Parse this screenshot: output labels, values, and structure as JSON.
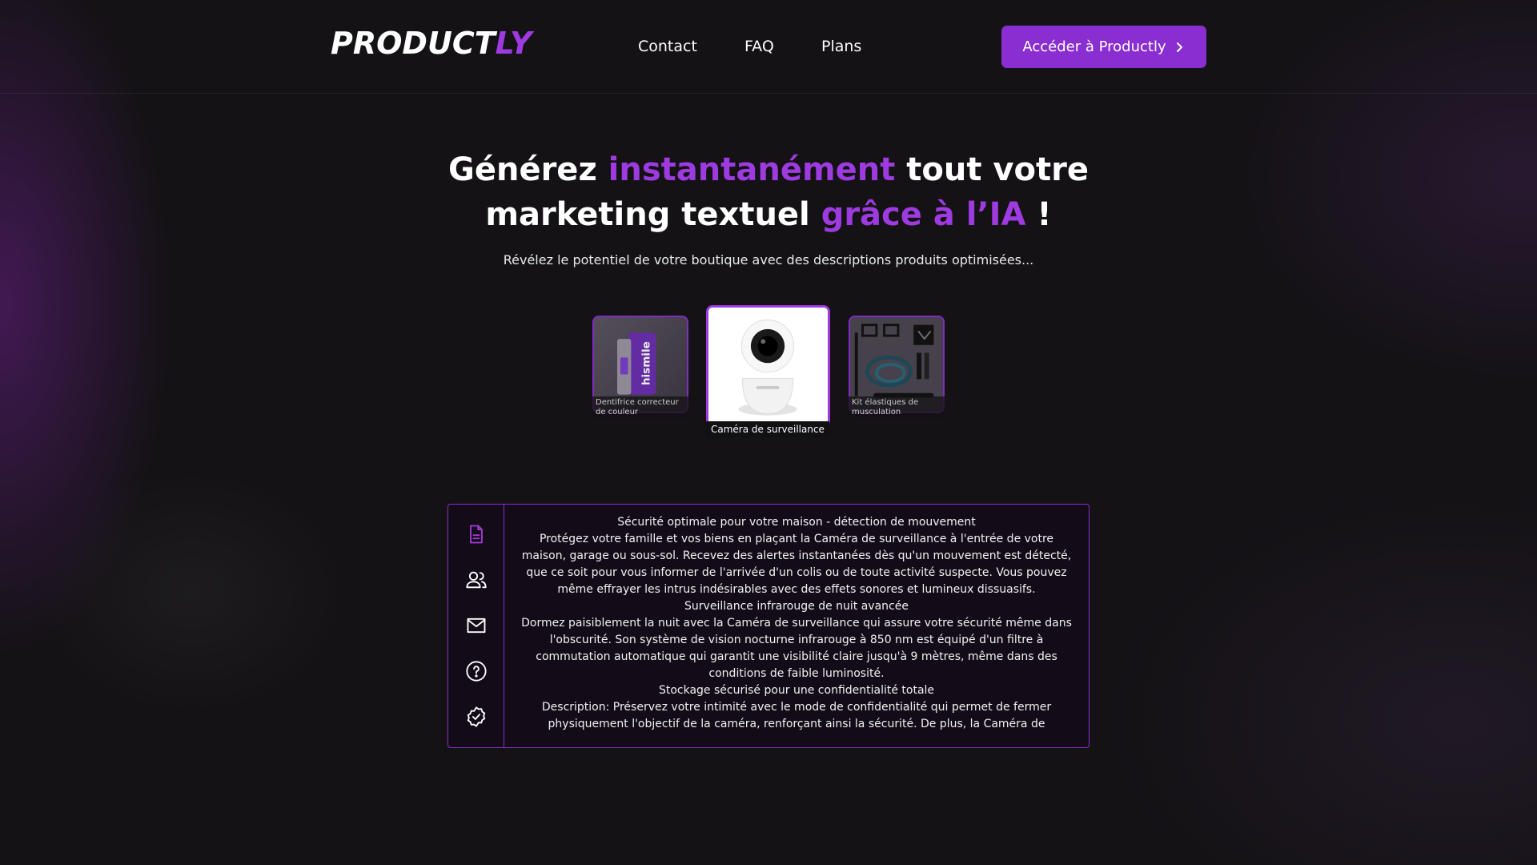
{
  "header": {
    "logo_main": "PRODUCT",
    "logo_accent": "LY",
    "nav": [
      {
        "label": "Contact"
      },
      {
        "label": "FAQ"
      },
      {
        "label": "Plans"
      }
    ],
    "cta_label": "Accéder à Productly",
    "cta_icon": "chevron-right-icon"
  },
  "hero": {
    "title_part1": "Générez ",
    "title_highlight1": "instantanément",
    "title_part2": " tout votre marketing textuel ",
    "title_highlight2": "grâce à l’IA",
    "title_part3": " !",
    "subtitle": "Révélez le potentiel de votre boutique avec des descriptions produits optimisées..."
  },
  "products": [
    {
      "caption": "Dentifrice correcteur de couleur",
      "image_icon": "toothpaste-product-image",
      "brand_text": "hismile",
      "selected": false
    },
    {
      "caption": "Caméra de surveillance",
      "image_icon": "security-camera-product-image",
      "brand_text": "",
      "selected": true
    },
    {
      "caption": "Kit élastiques de musculation",
      "image_icon": "resistance-bands-product-image",
      "brand_text": "",
      "selected": false
    }
  ],
  "panel": {
    "side_icons": [
      "document-icon",
      "users-icon",
      "mail-icon",
      "help-circle-icon",
      "badge-check-icon"
    ],
    "lines": [
      "Sécurité optimale pour votre maison - détection de mouvement",
      "Protégez votre famille et vos biens en plaçant la Caméra de surveillance à l'entrée de votre maison, garage ou sous-sol. Recevez des alertes instantanées dès qu'un mouvement est détecté, que ce soit pour vous informer de l'arrivée d'un colis ou de toute activité suspecte. Vous pouvez même effrayer les intrus indésirables avec des effets sonores et lumineux dissuasifs.",
      "Surveillance infrarouge de nuit avancée",
      "Dormez paisiblement la nuit avec la Caméra de surveillance qui assure votre sécurité même dans l'obscurité. Son système de vision nocturne infrarouge à 850 nm est équipé d'un filtre à commutation automatique qui garantit une visibilité claire jusqu'à 9 mètres, même dans des conditions de faible luminosité.",
      "Stockage sécurisé pour une confidentialité totale",
      "Description: Préservez votre intimité avec le mode de confidentialité qui permet de fermer physiquement l'objectif de la caméra, renforçant ainsi la sécurité. De plus, la Caméra de"
    ]
  },
  "colors": {
    "accent": "#8a2ed1",
    "accent_text": "#9d3ae0",
    "background": "#141215"
  }
}
